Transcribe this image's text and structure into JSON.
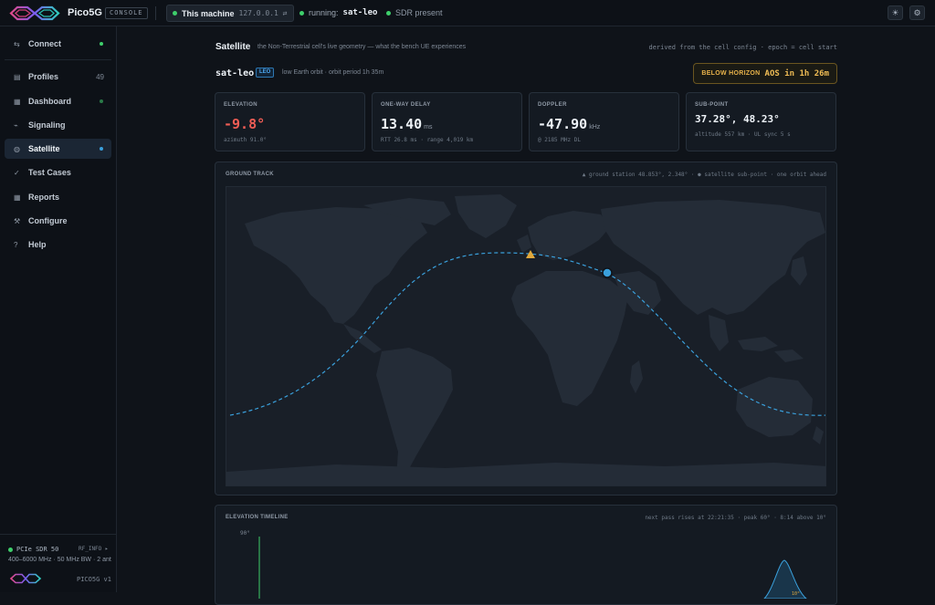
{
  "app": {
    "name": "Pico5G",
    "tag": "CONSOLE",
    "machine": "This machine",
    "ip": "127.0.0.1 ⇄",
    "running_label": "running:",
    "running_value": "sat-leo",
    "sdr_status": "SDR present",
    "theme_icon": "☀",
    "settings_icon": "⚙"
  },
  "sidebar": {
    "items": [
      {
        "icon": "⇆",
        "label": "Connect",
        "status": "green"
      },
      {
        "icon": "▤",
        "label": "Profiles",
        "badge": "49"
      },
      {
        "icon": "▦",
        "label": "Dashboard",
        "status": "dim-green"
      },
      {
        "icon": "⌁",
        "label": "Signaling"
      },
      {
        "icon": "◍",
        "label": "Satellite",
        "status": "blue",
        "active": true
      },
      {
        "icon": "✓",
        "label": "Test Cases"
      },
      {
        "icon": "▦",
        "label": "Reports"
      },
      {
        "icon": "⚒",
        "label": "Configure"
      },
      {
        "icon": "?",
        "label": "Help"
      }
    ],
    "footer": {
      "device": "PCIe SDR 50",
      "info": "RF_INFO ▸",
      "band": "400–6000 MHz · 50 MHz BW · 2 ant",
      "version": "PICO5G v1"
    }
  },
  "page": {
    "title": "Satellite",
    "subtitle": "the Non-Terrestrial cell's live geometry — what the bench UE experiences",
    "derived": "derived from the cell config · epoch = cell start",
    "sat_name": "sat-leo",
    "orbit_type": "LEO",
    "orbit_desc": "low Earth orbit · orbit period 1h 35m",
    "horizon_label": "BELOW HORIZON",
    "horizon_aos": "AOS in 1h 26m"
  },
  "cards": {
    "elevation": {
      "label": "ELEVATION",
      "value": "-9.8°",
      "sub": "azimuth 91.0°"
    },
    "delay": {
      "label": "ONE-WAY DELAY",
      "value": "13.40",
      "unit": "ms",
      "sub": "RTT 26.8 ms · range 4,019 km"
    },
    "doppler": {
      "label": "DOPPLER",
      "value": "-47.90",
      "unit": "kHz",
      "sub": "@ 2185 MHz DL"
    },
    "subpoint": {
      "label": "SUB-POINT",
      "value": "37.28°, 48.23°",
      "sub": "altitude 557 km · UL sync 5 s"
    }
  },
  "ground_track": {
    "title": "GROUND TRACK",
    "note": "▲ ground station 48.853°, 2.348° · ● satellite sub-point · one orbit ahead",
    "colors": {
      "track": "#3aa0dc",
      "station": "#e0a83c",
      "satellite": "#3aa0dc"
    }
  },
  "timeline": {
    "title": "ELEVATION TIMELINE",
    "note": "next pass rises at 22:21:35 · peak 60° · 8:14 above 10°",
    "y_label": "90°",
    "peak_label": "10°"
  }
}
